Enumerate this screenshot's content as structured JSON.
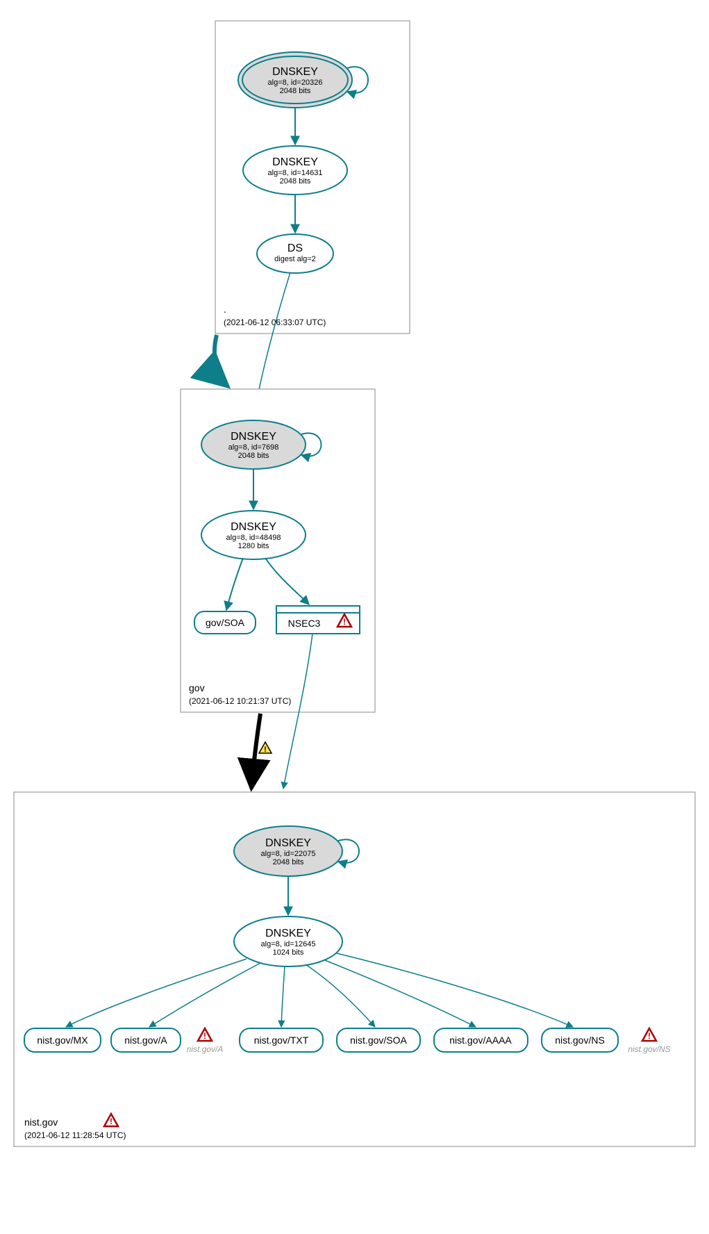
{
  "colors": {
    "stroke": "#0d7e8a",
    "fill_ksk": "#d9d9d9",
    "fill_white": "#ffffff",
    "box_stroke": "#888888",
    "black": "#000000",
    "warn_border": "#b00000",
    "warn_fill": "#ffffff",
    "caution_border": "#000000",
    "caution_fill": "#ffe24d"
  },
  "zones": {
    "root": {
      "label": ".",
      "time": "(2021-06-12 06:33:07 UTC)",
      "ksk": {
        "title": "DNSKEY",
        "sub1": "alg=8, id=20326",
        "sub2": "2048 bits"
      },
      "zsk": {
        "title": "DNSKEY",
        "sub1": "alg=8, id=14631",
        "sub2": "2048 bits"
      },
      "ds": {
        "title": "DS",
        "sub1": "digest alg=2"
      }
    },
    "gov": {
      "label": "gov",
      "time": "(2021-06-12 10:21:37 UTC)",
      "ksk": {
        "title": "DNSKEY",
        "sub1": "alg=8, id=7698",
        "sub2": "2048 bits"
      },
      "zsk": {
        "title": "DNSKEY",
        "sub1": "alg=8, id=48498",
        "sub2": "1280 bits"
      },
      "soa": {
        "label": "gov/SOA"
      },
      "nsec3": {
        "label": "NSEC3"
      }
    },
    "nist": {
      "label": "nist.gov",
      "time": "(2021-06-12 11:28:54 UTC)",
      "ksk": {
        "title": "DNSKEY",
        "sub1": "alg=8, id=22075",
        "sub2": "2048 bits"
      },
      "zsk": {
        "title": "DNSKEY",
        "sub1": "alg=8, id=12645",
        "sub2": "1024 bits"
      },
      "rr": {
        "mx": "nist.gov/MX",
        "a": "nist.gov/A",
        "txt": "nist.gov/TXT",
        "soa": "nist.gov/SOA",
        "aaaa": "nist.gov/AAAA",
        "ns": "nist.gov/NS"
      },
      "gray_a": "nist.gov/A",
      "gray_ns": "nist.gov/NS"
    }
  }
}
